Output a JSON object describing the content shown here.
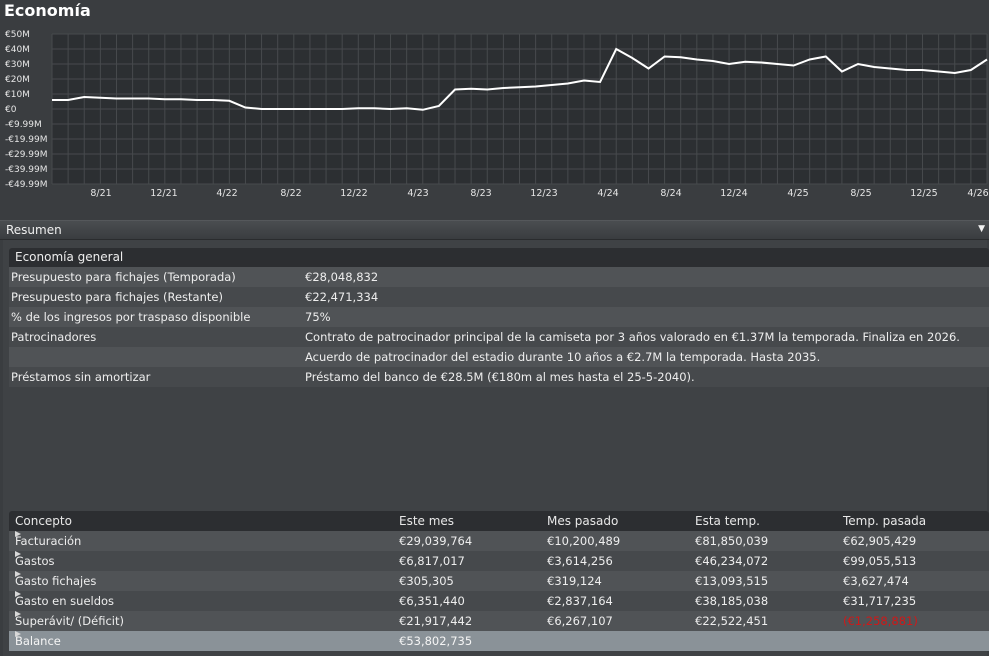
{
  "title": "Economía",
  "chart_data": {
    "type": "line",
    "y_ticks": [
      "€50M",
      "€40M",
      "€30M",
      "€20M",
      "€10M",
      "€0",
      "-€9.99M",
      "-€19.99M",
      "-€29.99M",
      "-€39.99M",
      "-€49.99M"
    ],
    "x_ticks": [
      "8/21",
      "12/21",
      "4/22",
      "8/22",
      "12/22",
      "4/23",
      "8/23",
      "12/23",
      "4/24",
      "8/24",
      "12/24",
      "4/25",
      "8/25",
      "12/25",
      "4/26"
    ],
    "ylim": [
      -50,
      50
    ],
    "grid": true,
    "values": [
      6,
      6,
      8,
      7.5,
      7,
      7,
      7,
      6.5,
      6.5,
      6,
      6,
      5.5,
      1,
      0,
      0,
      0,
      0,
      0,
      0,
      0.5,
      0.5,
      0,
      0.5,
      -0.5,
      2,
      13,
      13.5,
      13,
      14,
      14.5,
      15,
      16,
      17,
      19,
      18,
      40,
      34,
      27,
      35,
      34.5,
      33,
      32,
      30,
      31.5,
      31,
      30,
      29,
      33,
      35,
      25,
      30,
      28,
      27,
      26,
      26,
      25,
      24,
      26,
      33
    ]
  },
  "summary_bar": {
    "label": "Resumen"
  },
  "general": {
    "header": "Economía general",
    "rows": [
      {
        "k": "Presupuesto para fichajes (Temporada)",
        "v": "€28,048,832"
      },
      {
        "k": "Presupuesto para fichajes (Restante)",
        "v": "€22,471,334"
      },
      {
        "k": "% de los ingresos por traspaso disponible",
        "v": "75%"
      },
      {
        "k": "Patrocinadores",
        "v": "Contrato de patrocinador principal de la camiseta por 3 años valorado en €1.37M la temporada. Finaliza en 2026."
      },
      {
        "k": "",
        "v": "Acuerdo de patrocinador del estadio durante 10 años a €2.7M la temporada. Hasta 2035."
      },
      {
        "k": "Préstamos sin amortizar",
        "v": "Préstamo del banco de €28.5M (€180m al mes hasta el 25-5-2040)."
      }
    ]
  },
  "finances": {
    "headers": [
      "Concepto",
      "Este mes",
      "Mes pasado",
      "Esta temp.",
      "Temp. pasada"
    ],
    "rows": [
      {
        "name": "Facturación",
        "c1": "€29,039,764",
        "c2": "€10,200,489",
        "c3": "€81,850,039",
        "c4": "€62,905,429"
      },
      {
        "name": "Gastos",
        "c1": "€6,817,017",
        "c2": "€3,614,256",
        "c3": "€46,234,072",
        "c4": "€99,055,513"
      },
      {
        "name": "Gasto fichajes",
        "c1": "€305,305",
        "c2": "€319,124",
        "c3": "€13,093,515",
        "c4": "€3,627,474"
      },
      {
        "name": "Gasto en sueldos",
        "c1": "€6,351,440",
        "c2": "€2,837,164",
        "c3": "€38,185,038",
        "c4": "€31,717,235"
      },
      {
        "name": "Superávit/ (Déficit)",
        "c1": "€21,917,442",
        "c2": "€6,267,107",
        "c3": "€22,522,451",
        "c4": "(€1,258,881)"
      }
    ],
    "balance": {
      "name": "Balance",
      "c1": "€53,802,735"
    },
    "negative_color": "#d01818"
  }
}
